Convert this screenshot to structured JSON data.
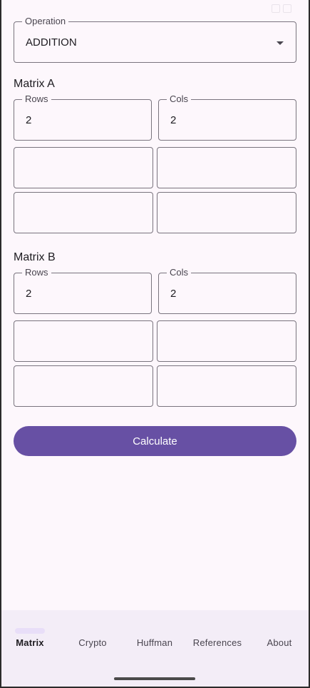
{
  "operation": {
    "label": "Operation",
    "value": "ADDITION"
  },
  "matrix_a": {
    "title": "Matrix A",
    "rows_label": "Rows",
    "rows_value": "2",
    "cols_label": "Cols",
    "cols_value": "2",
    "cells": [
      "",
      "",
      "",
      ""
    ]
  },
  "matrix_b": {
    "title": "Matrix B",
    "rows_label": "Rows",
    "rows_value": "2",
    "cols_label": "Cols",
    "cols_value": "2",
    "cells": [
      "",
      "",
      "",
      ""
    ]
  },
  "calculate_label": "Calculate",
  "nav": {
    "items": [
      {
        "label": "Matrix",
        "active": true
      },
      {
        "label": "Crypto",
        "active": false
      },
      {
        "label": "Huffman",
        "active": false
      },
      {
        "label": "References",
        "active": false
      },
      {
        "label": "About",
        "active": false
      }
    ]
  },
  "colors": {
    "accent": "#6750a4",
    "background": "#fdf7fc",
    "nav_background": "#f3edf7",
    "indicator": "#e8def8",
    "outline": "#79747e"
  }
}
